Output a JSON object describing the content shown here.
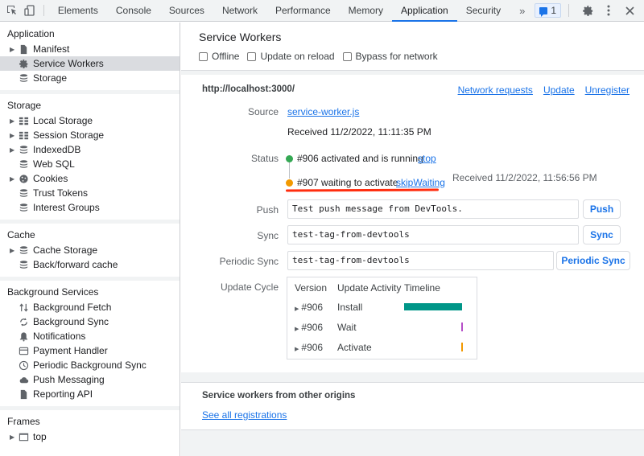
{
  "toolbar": {
    "tabs": [
      "Elements",
      "Console",
      "Sources",
      "Network",
      "Performance",
      "Memory",
      "Application",
      "Security"
    ],
    "active_tab": "Application",
    "more_label": "»",
    "issues_count": "1",
    "icons": [
      "inspect-element-icon",
      "device-toolbar-icon",
      "issues-icon",
      "gear-icon",
      "more-vert-icon",
      "close-icon"
    ]
  },
  "sidebar": {
    "sections": [
      {
        "title": "Application",
        "items": [
          {
            "label": "Manifest",
            "icon": "document",
            "expandable": true
          },
          {
            "label": "Service Workers",
            "icon": "gear",
            "expandable": false,
            "selected": true
          },
          {
            "label": "Storage",
            "icon": "database",
            "expandable": false
          }
        ]
      },
      {
        "title": "Storage",
        "items": [
          {
            "label": "Local Storage",
            "icon": "grid",
            "expandable": true
          },
          {
            "label": "Session Storage",
            "icon": "grid",
            "expandable": true
          },
          {
            "label": "IndexedDB",
            "icon": "database",
            "expandable": true
          },
          {
            "label": "Web SQL",
            "icon": "database",
            "expandable": false
          },
          {
            "label": "Cookies",
            "icon": "cookie",
            "expandable": true
          },
          {
            "label": "Trust Tokens",
            "icon": "database",
            "expandable": false
          },
          {
            "label": "Interest Groups",
            "icon": "database",
            "expandable": false
          }
        ]
      },
      {
        "title": "Cache",
        "items": [
          {
            "label": "Cache Storage",
            "icon": "database",
            "expandable": true
          },
          {
            "label": "Back/forward cache",
            "icon": "database",
            "expandable": false
          }
        ]
      },
      {
        "title": "Background Services",
        "items": [
          {
            "label": "Background Fetch",
            "icon": "arrows-updown",
            "expandable": false
          },
          {
            "label": "Background Sync",
            "icon": "sync",
            "expandable": false
          },
          {
            "label": "Notifications",
            "icon": "bell",
            "expandable": false
          },
          {
            "label": "Payment Handler",
            "icon": "card",
            "expandable": false
          },
          {
            "label": "Periodic Background Sync",
            "icon": "clock",
            "expandable": false
          },
          {
            "label": "Push Messaging",
            "icon": "cloud",
            "expandable": false
          },
          {
            "label": "Reporting API",
            "icon": "document",
            "expandable": false
          }
        ]
      },
      {
        "title": "Frames",
        "items": [
          {
            "label": "top",
            "icon": "frame",
            "expandable": true
          }
        ]
      }
    ]
  },
  "main": {
    "title": "Service Workers",
    "checkboxes": [
      {
        "label": "Offline",
        "checked": false
      },
      {
        "label": "Update on reload",
        "checked": false
      },
      {
        "label": "Bypass for network",
        "checked": false
      }
    ],
    "worker": {
      "origin": "http://localhost:3000/",
      "links": [
        "Network requests",
        "Update",
        "Unregister"
      ],
      "source_label": "Source",
      "source_file": "service-worker.js",
      "source_received": "Received 11/2/2022, 11:11:35 PM",
      "status_label": "Status",
      "status": [
        {
          "text": "#906 activated and is running",
          "action": "stop",
          "color": "#34a853"
        },
        {
          "text": "#907 waiting to activate",
          "action": "skipWaiting",
          "color": "#f29900",
          "received": "Received 11/2/2022, 11:56:56 PM"
        }
      ],
      "push": {
        "label": "Push",
        "value": "Test push message from DevTools.",
        "button": "Push"
      },
      "sync": {
        "label": "Sync",
        "value": "test-tag-from-devtools",
        "button": "Sync"
      },
      "periodic_sync": {
        "label": "Periodic Sync",
        "value": "test-tag-from-devtools",
        "button": "Periodic Sync"
      },
      "update_cycle": {
        "label": "Update Cycle",
        "headers": [
          "Version",
          "Update Activity",
          "Timeline"
        ],
        "rows": [
          {
            "version": "#906",
            "activity": "Install",
            "color": "#009688",
            "start": 0.0,
            "end": 1.0
          },
          {
            "version": "#906",
            "activity": "Wait",
            "color": "#b54ec8",
            "start": 0.99,
            "end": 1.0
          },
          {
            "version": "#906",
            "activity": "Activate",
            "color": "#f29900",
            "start": 0.99,
            "end": 1.0
          }
        ]
      }
    },
    "other_origins": {
      "title": "Service workers from other origins",
      "link": "See all registrations"
    },
    "annotation_color": "#ff2d0f"
  }
}
